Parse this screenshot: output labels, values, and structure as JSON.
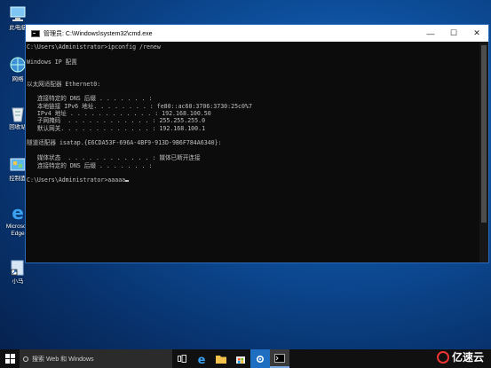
{
  "desktop": {
    "icons": [
      {
        "label": "此电脑",
        "icon": "computer-icon"
      },
      {
        "label": "网络",
        "icon": "network-icon"
      },
      {
        "label": "回收站",
        "icon": "recycle-bin-icon"
      },
      {
        "label": "控制面",
        "icon": "control-panel-icon"
      },
      {
        "label": "Microsoft Edge",
        "icon": "edge-icon"
      },
      {
        "label": "小马",
        "icon": "shortcut-icon"
      }
    ]
  },
  "window": {
    "title": "管理员: C:\\Windows\\system32\\cmd.exe",
    "controls": {
      "minimize": "—",
      "maximize": "☐",
      "close": "✕"
    }
  },
  "console": {
    "lines": [
      "C:\\Users\\Administrator>ipconfig /renew",
      "",
      "Windows IP 配置",
      "",
      "",
      "以太网适配器 Ethernet0:",
      "",
      "   连接特定的 DNS 后缀 . . . . . . . :",
      "   本地链接 IPv6 地址. . . . . . . . : fe80::ac60:3706:3730:25c0%7",
      "   IPv4 地址 . . . . . . . . . . . . : 192.168.100.50",
      "   子网掩码  . . . . . . . . . . . . : 255.255.255.0",
      "   默认网关. . . . . . . . . . . . . : 192.168.100.1",
      "",
      "隧道适配器 isatap.{E6CDA53F-696A-4BF9-913D-9B6F784A6340}:",
      "",
      "   媒体状态  . . . . . . . . . . . . : 媒体已断开连接",
      "   连接特定的 DNS 后缀 . . . . . . . :",
      "",
      "C:\\Users\\Administrator>aaaaa"
    ]
  },
  "taskbar": {
    "search_placeholder": "搜索 Web 和 Windows",
    "apps": [
      "task-view-icon",
      "edge-icon",
      "file-explorer-icon",
      "store-icon",
      "settings-icon",
      "cmd-icon"
    ]
  },
  "watermark": {
    "text": "亿速云"
  },
  "colors": {
    "console_bg": "#0c0c0c",
    "console_text": "#c0c0c0",
    "taskbar": "#101010",
    "accent": "#2a6ab8"
  }
}
